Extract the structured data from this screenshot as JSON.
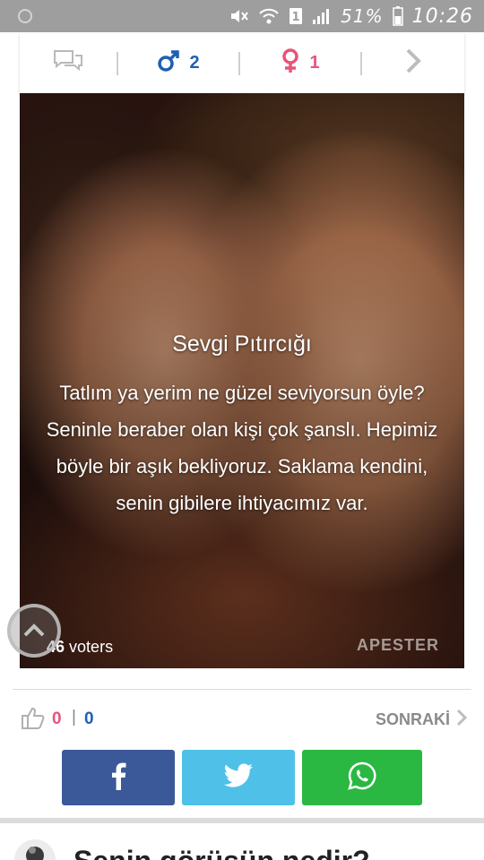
{
  "status_bar": {
    "battery_percent": "51%",
    "time": "10:26",
    "icons": [
      "mute-icon",
      "wifi-icon",
      "sim-icon",
      "signal-icon",
      "battery-icon"
    ]
  },
  "top_bar": {
    "male_count": "2",
    "female_count": "1",
    "icons": [
      "comments-icon",
      "male-icon",
      "female-icon",
      "chevron-right-icon"
    ],
    "colors": {
      "male": "#1f5fb5",
      "female": "#e8547b"
    }
  },
  "result": {
    "title": "Sevgi Pıtırcığı",
    "description": "Tatlım ya yerim ne güzel seviyorsun öyle? Seninle beraber olan kişi çok şanslı. Hepimiz böyle bir aşık bekliyoruz. Saklama kendini, senin gibilere ihtiyacımız var.",
    "voters_count": "46",
    "voters_label": "voters",
    "brand": "APESTER"
  },
  "rating": {
    "likes": "0",
    "separator": "|",
    "dislikes": "0",
    "next_label": "SONRAKİ"
  },
  "share": {
    "buttons": [
      "facebook",
      "twitter",
      "whatsapp"
    ],
    "colors": {
      "facebook": "#3b5998",
      "twitter": "#4fc1e9",
      "whatsapp": "#2ab843"
    }
  },
  "comments": {
    "title": "Senin görüşün nedir?"
  }
}
